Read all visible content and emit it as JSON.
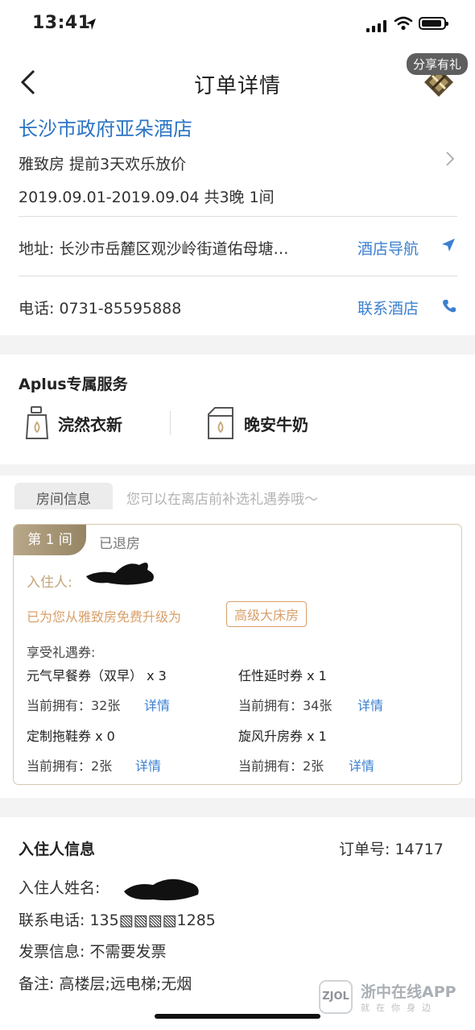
{
  "status_bar": {
    "time": "13:41"
  },
  "nav": {
    "title": "订单详情",
    "share_label": "分享有礼"
  },
  "hotel": {
    "name": "长沙市政府亚朵酒店",
    "room_line": "雅致房  提前3天欢乐放价",
    "date_line": "2019.09.01-2019.09.04   共3晚 1间",
    "address": "地址: 长沙市岳麓区观沙岭街道佑母塘…",
    "address_link": "酒店导航",
    "phone": "电话: 0731-85595888",
    "phone_link": "联系酒店"
  },
  "aplus": {
    "title": "Aplus专属服务",
    "services": [
      {
        "label": "浣然衣新",
        "icon": "detergent-bottle-icon"
      },
      {
        "label": "晚安牛奶",
        "icon": "milk-carton-icon"
      }
    ]
  },
  "room_info": {
    "tab_label": "房间信息",
    "hint": "您可以在离店前补选礼遇券哦～",
    "room_tag": "第 1 间",
    "status": "已退房",
    "guest_label": "入住人:",
    "upgrade_text": "已为您从雅致房免费升级为",
    "upgrade_badge": "高级大床房",
    "enjoy_label": "享受礼遇券:",
    "coupons": [
      {
        "name": "元气早餐券（双早） x 3",
        "owned": "当前拥有：32张",
        "detail": "详情"
      },
      {
        "name": "任性延时券 x 1",
        "owned": "当前拥有：34张",
        "detail": "详情"
      },
      {
        "name": "定制拖鞋券 x 0",
        "owned": "当前拥有：2张",
        "detail": "详情"
      },
      {
        "name": "旋风升房券 x 1",
        "owned": "当前拥有：2张",
        "detail": "详情"
      }
    ]
  },
  "guest_info": {
    "title": "入住人信息",
    "order_no": "订单号:  14717",
    "name_label": "入住人姓名:",
    "phone": "联系电话: 135▧▧▧▧1285",
    "invoice": "发票信息:  不需要发票",
    "remark": "备注:  高楼层;远电梯;无烟"
  },
  "watermark": {
    "logo": "ZJOL",
    "title": "浙中在线APP",
    "subtitle": "就在你身边"
  },
  "colors": {
    "link": "#3b7fd0",
    "gold": "#d8a06b",
    "hotel_name": "#2b74c4"
  }
}
